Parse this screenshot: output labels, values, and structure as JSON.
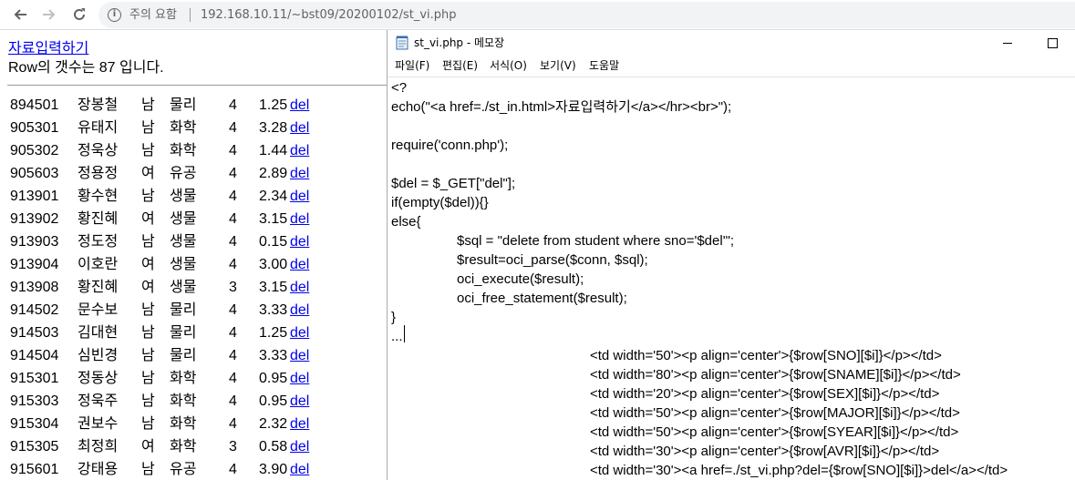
{
  "browser": {
    "security_label": "주의 요함",
    "url": "192.168.10.11/~bst09/20200102/st_vi.php"
  },
  "page": {
    "link_label": "자료입력하기",
    "row_count_text": "Row의 갯수는 87 입니다.",
    "rows": [
      {
        "sno": "894501",
        "name": "장봉철",
        "sex": "남",
        "major": "물리",
        "syear": "4",
        "avr": "1.25",
        "del": "del"
      },
      {
        "sno": "905301",
        "name": "유태지",
        "sex": "남",
        "major": "화학",
        "syear": "4",
        "avr": "3.28",
        "del": "del"
      },
      {
        "sno": "905302",
        "name": "정욱상",
        "sex": "남",
        "major": "화학",
        "syear": "4",
        "avr": "1.44",
        "del": "del"
      },
      {
        "sno": "905603",
        "name": "정용정",
        "sex": "여",
        "major": "유공",
        "syear": "4",
        "avr": "2.89",
        "del": "del"
      },
      {
        "sno": "913901",
        "name": "황수현",
        "sex": "남",
        "major": "생물",
        "syear": "4",
        "avr": "2.34",
        "del": "del"
      },
      {
        "sno": "913902",
        "name": "황진혜",
        "sex": "여",
        "major": "생물",
        "syear": "4",
        "avr": "3.15",
        "del": "del"
      },
      {
        "sno": "913903",
        "name": "정도정",
        "sex": "남",
        "major": "생물",
        "syear": "4",
        "avr": "0.15",
        "del": "del"
      },
      {
        "sno": "913904",
        "name": "이호란",
        "sex": "여",
        "major": "생물",
        "syear": "4",
        "avr": "3.00",
        "del": "del"
      },
      {
        "sno": "913908",
        "name": "황진혜",
        "sex": "여",
        "major": "생물",
        "syear": "3",
        "avr": "3.15",
        "del": "del"
      },
      {
        "sno": "914502",
        "name": "문수보",
        "sex": "남",
        "major": "물리",
        "syear": "4",
        "avr": "3.33",
        "del": "del"
      },
      {
        "sno": "914503",
        "name": "김대현",
        "sex": "남",
        "major": "물리",
        "syear": "4",
        "avr": "1.25",
        "del": "del"
      },
      {
        "sno": "914504",
        "name": "심빈경",
        "sex": "남",
        "major": "물리",
        "syear": "4",
        "avr": "3.33",
        "del": "del"
      },
      {
        "sno": "915301",
        "name": "정동상",
        "sex": "남",
        "major": "화학",
        "syear": "4",
        "avr": "0.95",
        "del": "del"
      },
      {
        "sno": "915303",
        "name": "정욱주",
        "sex": "남",
        "major": "화학",
        "syear": "4",
        "avr": "0.95",
        "del": "del"
      },
      {
        "sno": "915304",
        "name": "권보수",
        "sex": "남",
        "major": "화학",
        "syear": "4",
        "avr": "2.32",
        "del": "del"
      },
      {
        "sno": "915305",
        "name": "최정희",
        "sex": "여",
        "major": "화학",
        "syear": "3",
        "avr": "0.58",
        "del": "del"
      },
      {
        "sno": "915601",
        "name": "강태용",
        "sex": "남",
        "major": "유공",
        "syear": "4",
        "avr": "3.90",
        "del": "del"
      }
    ]
  },
  "notepad": {
    "title": "st_vi.php - 메모장",
    "menu": [
      "파일(F)",
      "편집(E)",
      "서식(O)",
      "보기(V)",
      "도움말"
    ],
    "lines": [
      "<?",
      "echo(\"<a href=./st_in.html>자료입력하기</a></hr><br>\");",
      "",
      "require('conn.php');",
      "",
      "$del = $_GET[\"del\"];",
      "if(empty($del)){}",
      "else{",
      "$sql = \"delete from student where sno='$del'\";",
      "$result=oci_parse($conn, $sql);",
      "oci_execute($result);",
      "oci_free_statement($result);",
      "}",
      "...",
      "<td width='50'><p align='center'>{$row[SNO][$i]}</p></td>",
      "<td width='80'><p align='center'>{$row[SNAME][$i]}</p></td>",
      "<td width='20'><p align='center'>{$row[SEX][$i]}</p></td>",
      "<td width='50'><p align='center'>{$row[MAJOR][$i]}</p></td>",
      "<td width='50'><p align='center'>{$row[SYEAR][$i]}</p></td>",
      "<td width='30'><p align='center'>{$row[AVR][$i]}</p></td>",
      "<td width='30'><a href=./st_vi.php?del={$row[SNO][$i]}>del</a></td>"
    ]
  }
}
